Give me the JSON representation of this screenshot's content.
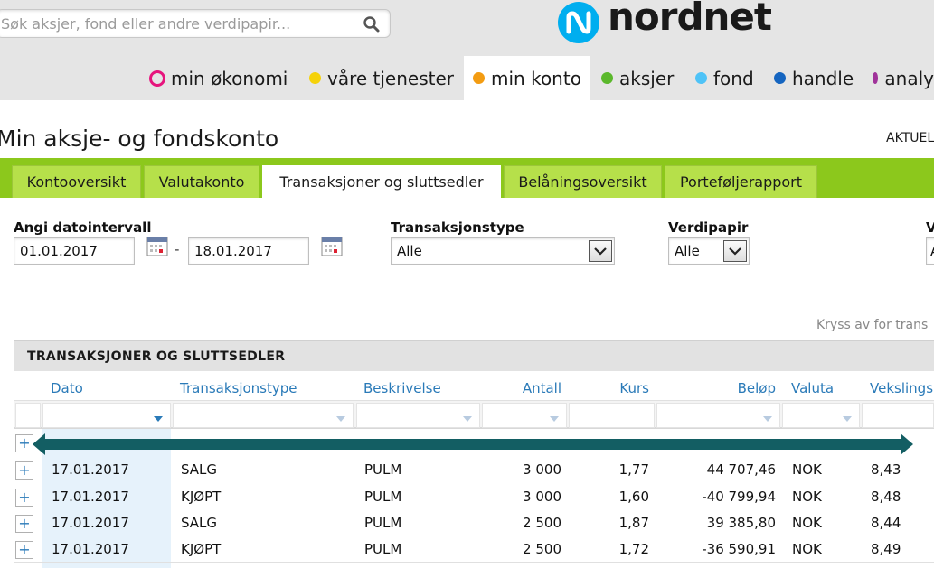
{
  "header": {
    "search_placeholder": "Søk aksjer, fond eller andre verdipapir...",
    "logo_text": "nordnet",
    "nav": [
      {
        "label": "min økonomi",
        "color": "#e6157d",
        "ring": true
      },
      {
        "label": "våre tjenester",
        "color": "#f5d20a"
      },
      {
        "label": "min konto",
        "color": "#f39c12",
        "active": true
      },
      {
        "label": "aksjer",
        "color": "#5bb82c"
      },
      {
        "label": "fond",
        "color": "#4fc3f7"
      },
      {
        "label": "handle",
        "color": "#1565c0"
      },
      {
        "label": "analy",
        "color": "#a0339a"
      }
    ]
  },
  "page": {
    "title": "Min aksje- og fondskonto",
    "aktuel": "AKTUEL"
  },
  "tabs": [
    {
      "label": "Kontooversikt"
    },
    {
      "label": "Valutakonto"
    },
    {
      "label": "Transaksjoner og sluttsedler",
      "active": true
    },
    {
      "label": "Belåningsoversikt"
    },
    {
      "label": "Porteføljerapport"
    }
  ],
  "filters": {
    "date_label": "Angi datointervall",
    "date_from": "01.01.2017",
    "date_sep": "-",
    "date_to": "18.01.2017",
    "type_label": "Transaksjonstype",
    "type_value": "Alle",
    "security_label": "Verdipapir",
    "security_value": "Alle",
    "cut_label": "V",
    "cut_value": "A"
  },
  "kryss": "Kryss av for trans",
  "table": {
    "title": "TRANSAKSJONER OG SLUTTSEDLER",
    "columns": [
      "Dato",
      "Transaksjonstype",
      "Beskrivelse",
      "Antall",
      "Kurs",
      "Beløp",
      "Valuta",
      "Vekslings"
    ],
    "rows": [
      {
        "dato": "17.01.2017",
        "type": "SALG",
        "beskrivelse": "PULM",
        "antall": "3 000",
        "kurs": "1,77",
        "belop": "44 707,46",
        "valuta": "NOK",
        "veksling": "8,43"
      },
      {
        "dato": "17.01.2017",
        "type": "KJØPT",
        "beskrivelse": "PULM",
        "antall": "3 000",
        "kurs": "1,60",
        "belop": "-40 799,94",
        "valuta": "NOK",
        "veksling": "8,48"
      },
      {
        "dato": "17.01.2017",
        "type": "SALG",
        "beskrivelse": "PULM",
        "antall": "2 500",
        "kurs": "1,87",
        "belop": "39 385,80",
        "valuta": "NOK",
        "veksling": "8,44"
      },
      {
        "dato": "17.01.2017",
        "type": "KJØPT",
        "beskrivelse": "PULM",
        "antall": "2 500",
        "kurs": "1,72",
        "belop": "-36 590,91",
        "valuta": "NOK",
        "veksling": "8,49"
      }
    ],
    "expand_symbol": "+"
  },
  "colors": {
    "tab_green": "#8cc81c",
    "link_blue": "#2a7ab8",
    "arrow_teal": "#135e63"
  }
}
